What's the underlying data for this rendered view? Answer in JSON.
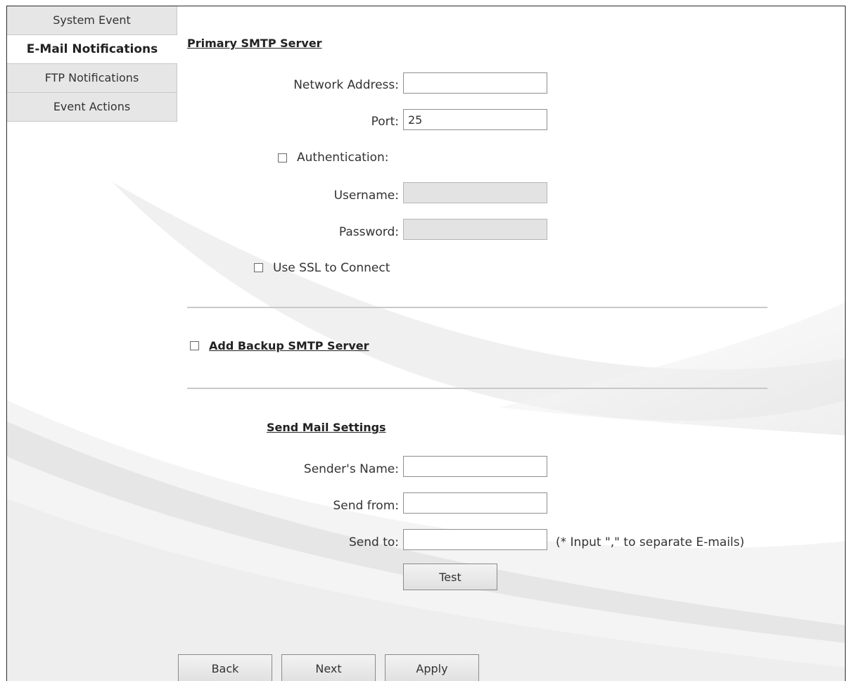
{
  "sidebar": {
    "items": [
      {
        "label": "System Event"
      },
      {
        "label": "E-Mail Notifications"
      },
      {
        "label": "FTP Notifications"
      },
      {
        "label": "Event Actions"
      }
    ]
  },
  "primary_smtp": {
    "heading": "Primary SMTP Server",
    "network_address_label": "Network Address:",
    "network_address_value": "",
    "port_label": "Port:",
    "port_value": "25",
    "authentication_label": "Authentication:",
    "username_label": "Username:",
    "username_value": "",
    "password_label": "Password:",
    "password_value": "",
    "ssl_label": "Use SSL to Connect"
  },
  "backup_smtp": {
    "label": "Add Backup SMTP Server"
  },
  "send_mail": {
    "heading": "Send Mail Settings",
    "senders_name_label": "Sender's Name:",
    "senders_name_value": "",
    "send_from_label": "Send from:",
    "send_from_value": "",
    "send_to_label": "Send to:",
    "send_to_value": "",
    "send_to_hint": "(* Input \",\" to separate E-mails)",
    "test_label": "Test"
  },
  "footer": {
    "back_label": "Back",
    "next_label": "Next",
    "apply_label": "Apply"
  }
}
